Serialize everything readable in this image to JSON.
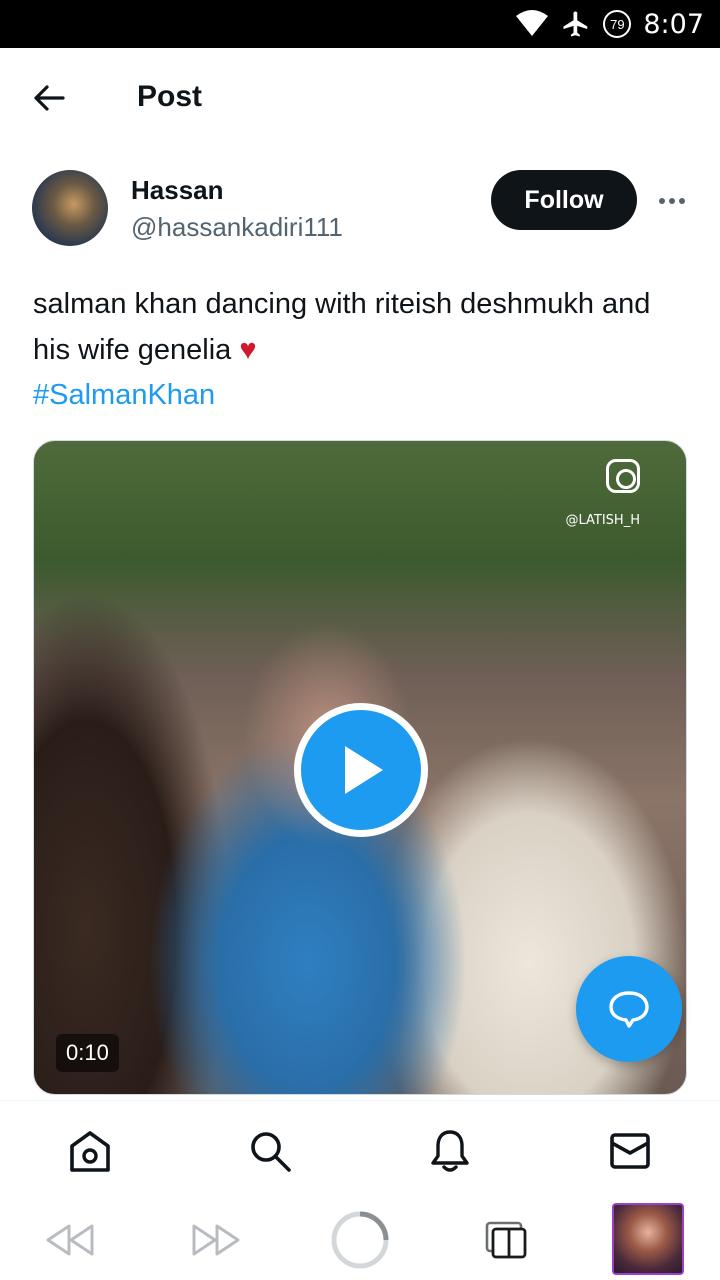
{
  "status_bar": {
    "time": "8:07",
    "battery": "79"
  },
  "header": {
    "title": "Post"
  },
  "author": {
    "name": "Hassan",
    "handle": "@hassankadiri111"
  },
  "follow_label": "Follow",
  "post": {
    "text": "salman khan dancing with riteish deshmukh and his wife genelia",
    "emoji": "♥",
    "hashtag": "#SalmanKhan"
  },
  "media": {
    "watermark": "@LATISH_H",
    "duration": "0:10"
  },
  "colors": {
    "accent": "#1d9bf0",
    "text": "#0f1419",
    "muted": "#536471",
    "heart": "#d1192f"
  },
  "tabs": [
    "home-icon",
    "search-icon",
    "notifications-icon",
    "messages-icon"
  ],
  "system_nav": [
    "rewind-icon",
    "fast-forward-icon",
    "circle-icon",
    "tabs-icon",
    "thumbnail"
  ]
}
